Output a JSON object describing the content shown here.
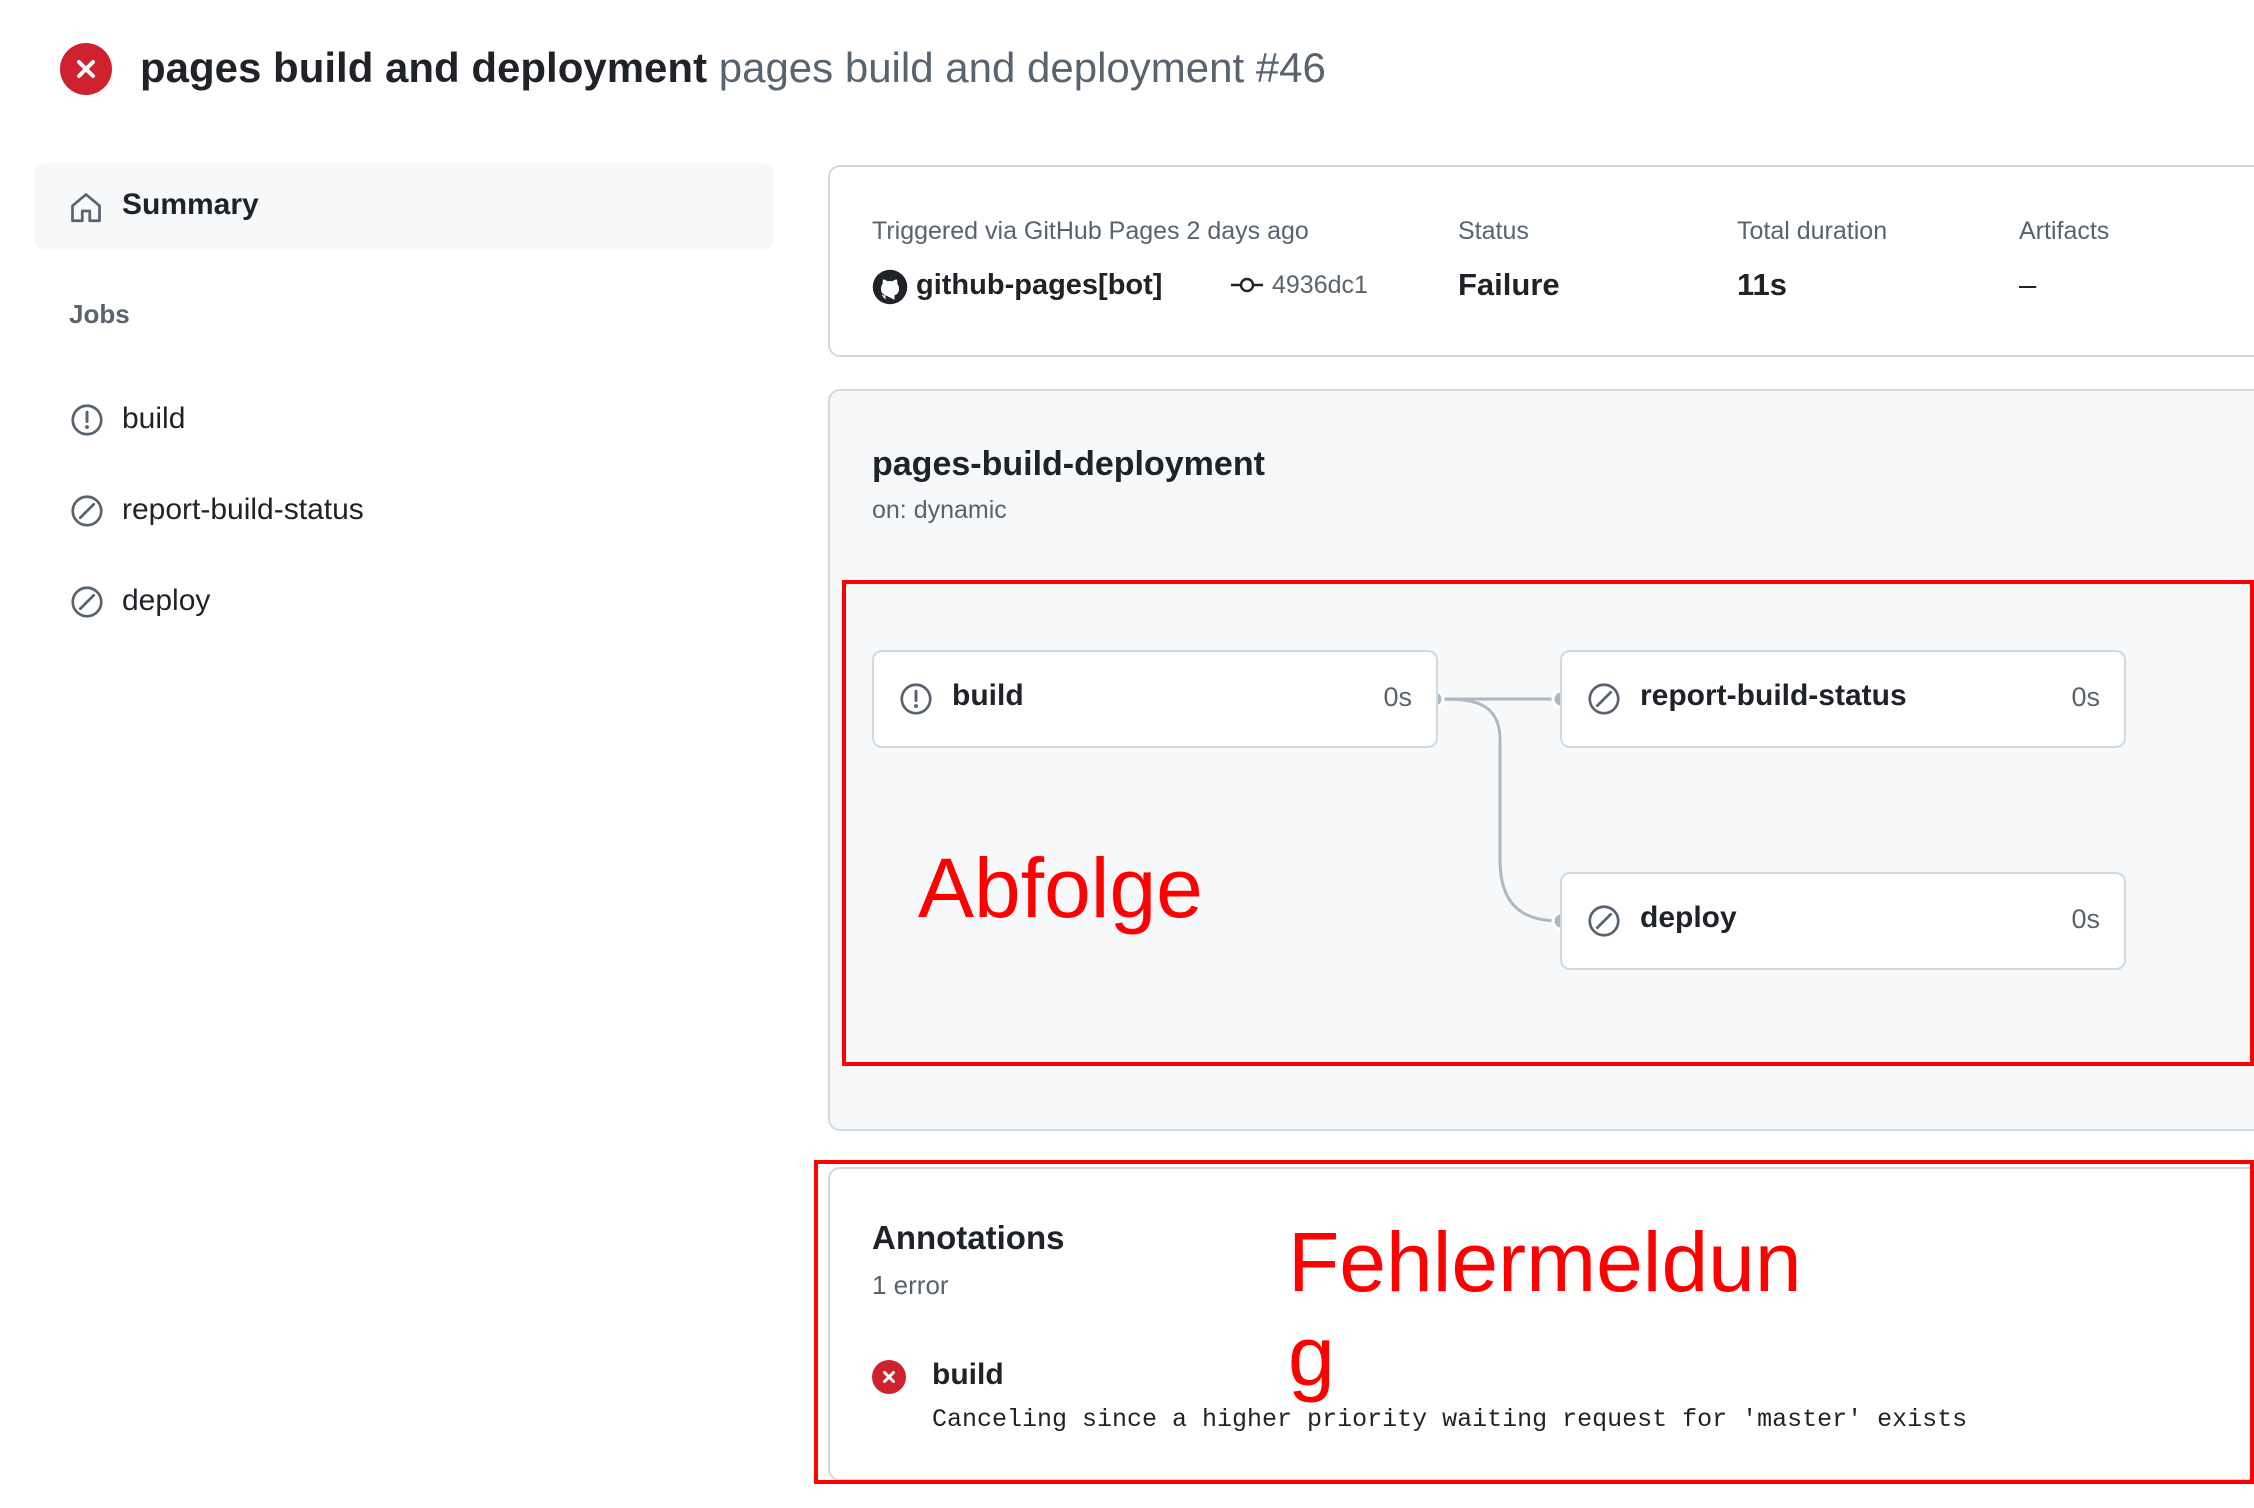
{
  "header": {
    "workflow_name": "pages build and deployment",
    "run_title": "pages build and deployment #46",
    "status_icon": "x-circle-fill-icon",
    "status_color": "#cf222e"
  },
  "sidebar": {
    "summary_label": "Summary",
    "jobs_heading": "Jobs",
    "jobs": [
      {
        "label": "build",
        "icon": "alert-icon"
      },
      {
        "label": "report-build-status",
        "icon": "skip-icon"
      },
      {
        "label": "deploy",
        "icon": "skip-icon"
      }
    ]
  },
  "run_info": {
    "trigger_label": "Triggered via GitHub Pages 2 days ago",
    "actor": "github-pages[bot]",
    "commit_sha": "4936dc1",
    "status_label": "Status",
    "status_value": "Failure",
    "duration_label": "Total duration",
    "duration_value": "11s",
    "artifacts_label": "Artifacts",
    "artifacts_value": "–"
  },
  "workflow_graph": {
    "name": "pages-build-deployment",
    "trigger": "on: dynamic",
    "jobs": [
      {
        "label": "build",
        "duration": "0s",
        "icon": "alert-icon"
      },
      {
        "label": "report-build-status",
        "duration": "0s",
        "icon": "skip-icon"
      },
      {
        "label": "deploy",
        "duration": "0s",
        "icon": "skip-icon"
      }
    ],
    "connector_color": "#afb8c1"
  },
  "annotations": {
    "title": "Annotations",
    "count": "1 error",
    "items": [
      {
        "job": "build",
        "message": "Canceling since a higher priority waiting request for 'master' exists",
        "icon": "x-circle-fill-icon"
      }
    ]
  },
  "overlay": {
    "box_color": "#ff0000",
    "sequence_label": "Abfolge",
    "error_label_line1": "Fehlermeldun",
    "error_label_line2": "g"
  }
}
